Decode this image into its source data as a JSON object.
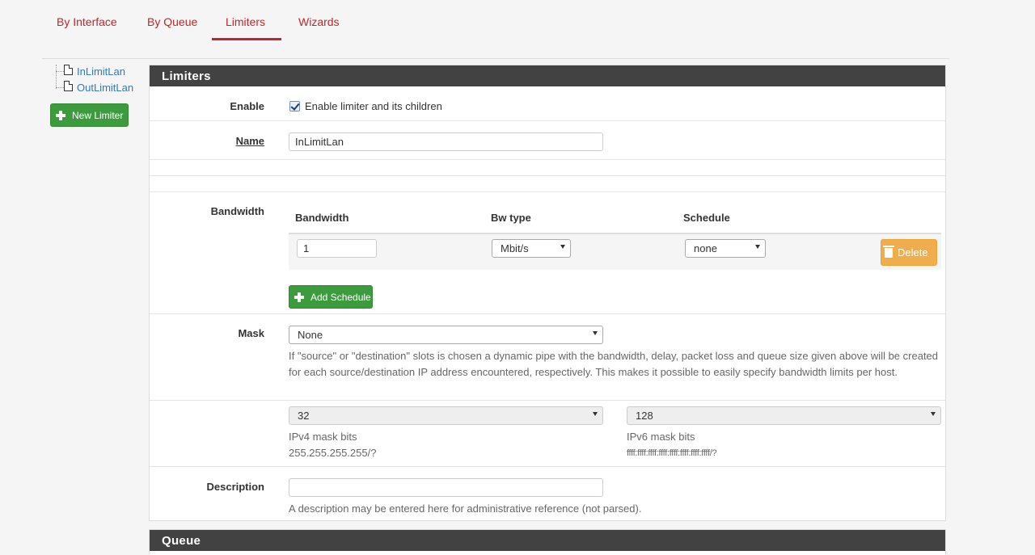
{
  "tabs": [
    {
      "label": "By Interface"
    },
    {
      "label": "By Queue"
    },
    {
      "label": "Limiters"
    },
    {
      "label": "Wizards"
    }
  ],
  "tree": {
    "items": [
      {
        "label": "InLimitLan"
      },
      {
        "label": "OutLimitLan"
      }
    ],
    "new_button": "New Limiter"
  },
  "limiters_panel": {
    "title": "Limiters",
    "enable": {
      "label": "Enable",
      "checkbox_label": "Enable limiter and its children",
      "checked": true
    },
    "name": {
      "label": "Name",
      "value": "InLimitLan"
    },
    "bandwidth": {
      "label": "Bandwidth",
      "columns": [
        "Bandwidth",
        "Bw type",
        "Schedule"
      ],
      "row": {
        "bandwidth": "1",
        "bw_type": "Mbit/s",
        "schedule": "none"
      },
      "delete_label": "Delete",
      "add_schedule_label": "Add Schedule"
    },
    "mask": {
      "label": "Mask",
      "value": "None",
      "help": "If \"source\" or \"destination\" slots is chosen a dynamic pipe with the bandwidth, delay, packet loss and queue size given above will be created for each source/destination IP address encountered, respectively. This makes it possible to easily specify bandwidth limits per host.",
      "ipv4_value": "32",
      "ipv4_help_title": "IPv4 mask bits",
      "ipv4_help_sub": "255.255.255.255/?",
      "ipv6_value": "128",
      "ipv6_help_title": "IPv6 mask bits",
      "ipv6_help_sub": "ffff:ffff:ffff:ffff:ffff:ffff:ffff:ffff/?"
    },
    "description": {
      "label": "Description",
      "value": "",
      "help": "A description may be entered here for administrative reference (not parsed)."
    }
  },
  "queue_panel": {
    "title": "Queue"
  },
  "colors": {
    "accent": "#c0262b",
    "heading": "#424242",
    "success": "#3c9b3c",
    "warning": "#f0ad4e",
    "link": "#337ab7"
  }
}
